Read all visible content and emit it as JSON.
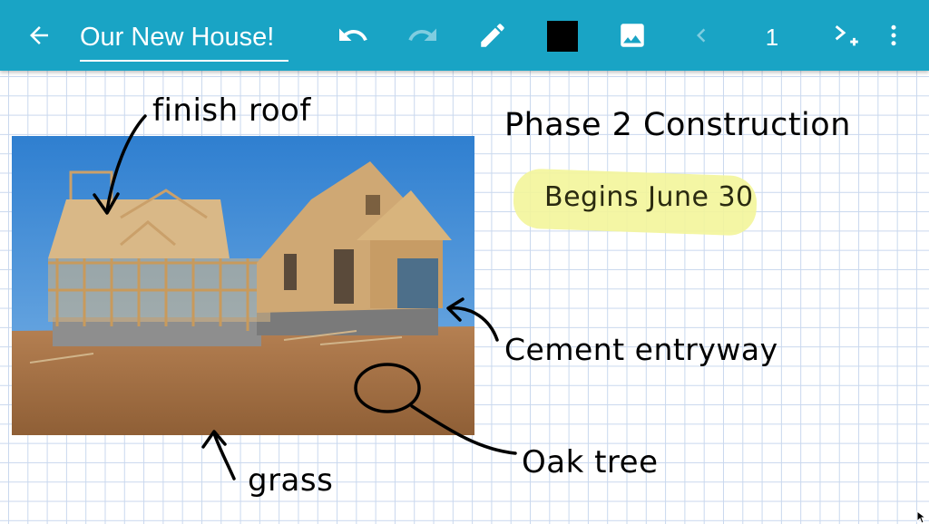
{
  "toolbar": {
    "back_icon": "arrow-left-icon",
    "title": "Our New House!",
    "undo_icon": "undo-icon",
    "redo_icon": "redo-icon",
    "pen_icon": "pencil-icon",
    "color": "#000000",
    "image_icon": "image-icon",
    "prev_icon": "chevron-left-icon",
    "page_number": "1",
    "add_page_icon": "add-page-icon",
    "more_icon": "more-vert-icon",
    "accent_color": "#19a4c5"
  },
  "canvas": {
    "annotations": {
      "finish_roof": "finish roof",
      "phase": "Phase 2 Construction",
      "begins": "Begins June 30",
      "cement": "Cement entryway",
      "oak": "Oak tree",
      "grass": "grass"
    },
    "highlight_color": "#f3f59a"
  }
}
